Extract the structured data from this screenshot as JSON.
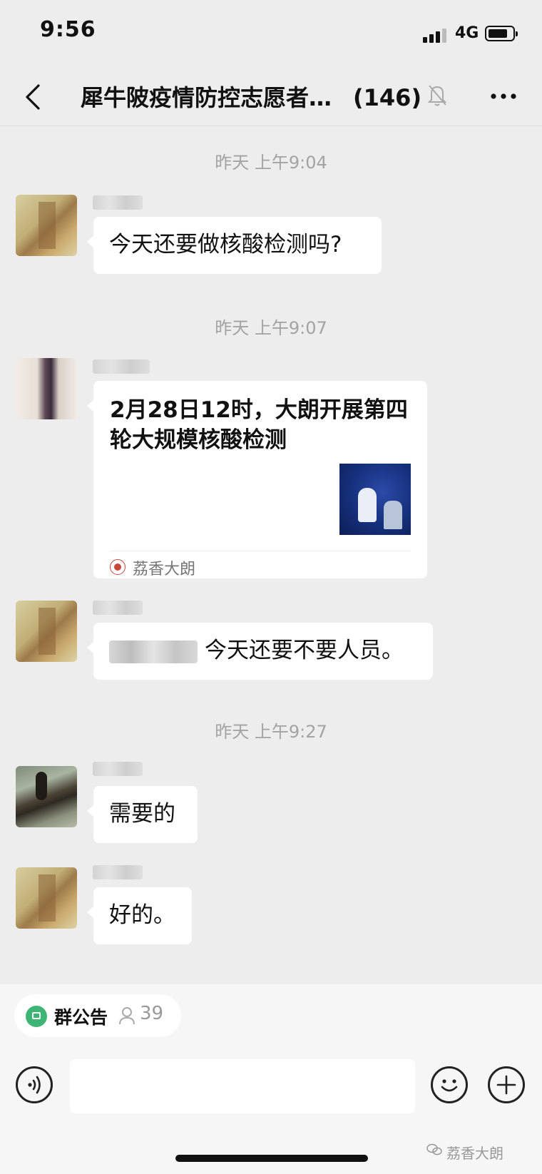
{
  "status_bar": {
    "time": "9:56",
    "network": "4G"
  },
  "header": {
    "title": "犀牛陂疫情防控志愿者…",
    "member_count": "(146)"
  },
  "messages": [
    {
      "timestamp": "昨天 上午9:04",
      "text": "今天还要做核酸检测吗?"
    },
    {
      "timestamp": "昨天 上午9:07",
      "card": {
        "title": "2月28日12时，大朗开展第四轮大规模核酸检测",
        "source": "荔香大朗"
      }
    },
    {
      "text": "今天还要不要人员。"
    },
    {
      "timestamp": "昨天 上午9:27",
      "text": "需要的"
    },
    {
      "text": "好的。"
    }
  ],
  "bottom": {
    "notice_label": "群公告",
    "notice_count": "39"
  },
  "watermark": "荔香大朗",
  "colors": {
    "background": "#ededed",
    "bubble": "#ffffff",
    "notice_green": "#3eb575",
    "timestamp": "#a3a3a3"
  },
  "icons": [
    "back-icon",
    "mute-bell-icon",
    "more-icon",
    "voice-icon",
    "emoji-icon",
    "plus-icon",
    "people-icon",
    "notice-icon"
  ]
}
